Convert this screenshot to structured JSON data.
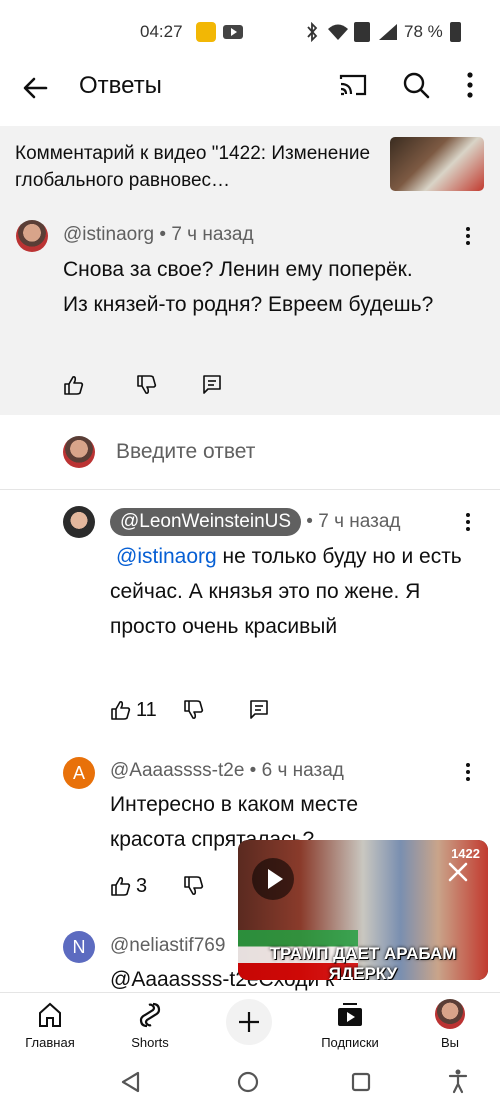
{
  "status_bar": {
    "time": "04:27",
    "battery": "78 %"
  },
  "header": {
    "title": "Ответы"
  },
  "video_context": {
    "text": "Комментарий к видео \"1422: Изменение глобального равновес…"
  },
  "parent_comment": {
    "author": "@istinaorg",
    "time": "7 ч назад",
    "text": "Снова за свое? Ленин ему поперёк. Из князей-то родня? Евреем будешь?"
  },
  "reply_input": {
    "placeholder": "Введите ответ"
  },
  "replies": [
    {
      "author": "@LeonWeinsteinUS",
      "time": "7 ч назад",
      "mention": "@istinaorg",
      "text": " не только буду но и есть сейчас. А князья это по жене. Я просто очень красивый",
      "likes": "11"
    },
    {
      "author": "@Aaaassss-t2e",
      "time": "6 ч назад",
      "avatar_letter": "A",
      "text": "Интересно в каком месте красота спряталась?",
      "likes": "3"
    },
    {
      "author": "@neliastif769",
      "avatar_letter": "N",
      "text": "@Aaaassss-t2eСходи к"
    }
  ],
  "mini_player": {
    "overlay_number": "1422",
    "caption": "ТРАМП ДАЕТ АРАБАМ ЯДЕРКУ"
  },
  "bottom_nav": {
    "home": "Главная",
    "shorts": "Shorts",
    "subscriptions": "Подписки",
    "you": "Вы"
  },
  "colors": {
    "accent_blue": "#065fd4",
    "orange_avatar": "#e8710a",
    "blue_avatar": "#5c6bc0",
    "gray_bg": "#f2f2f2"
  }
}
